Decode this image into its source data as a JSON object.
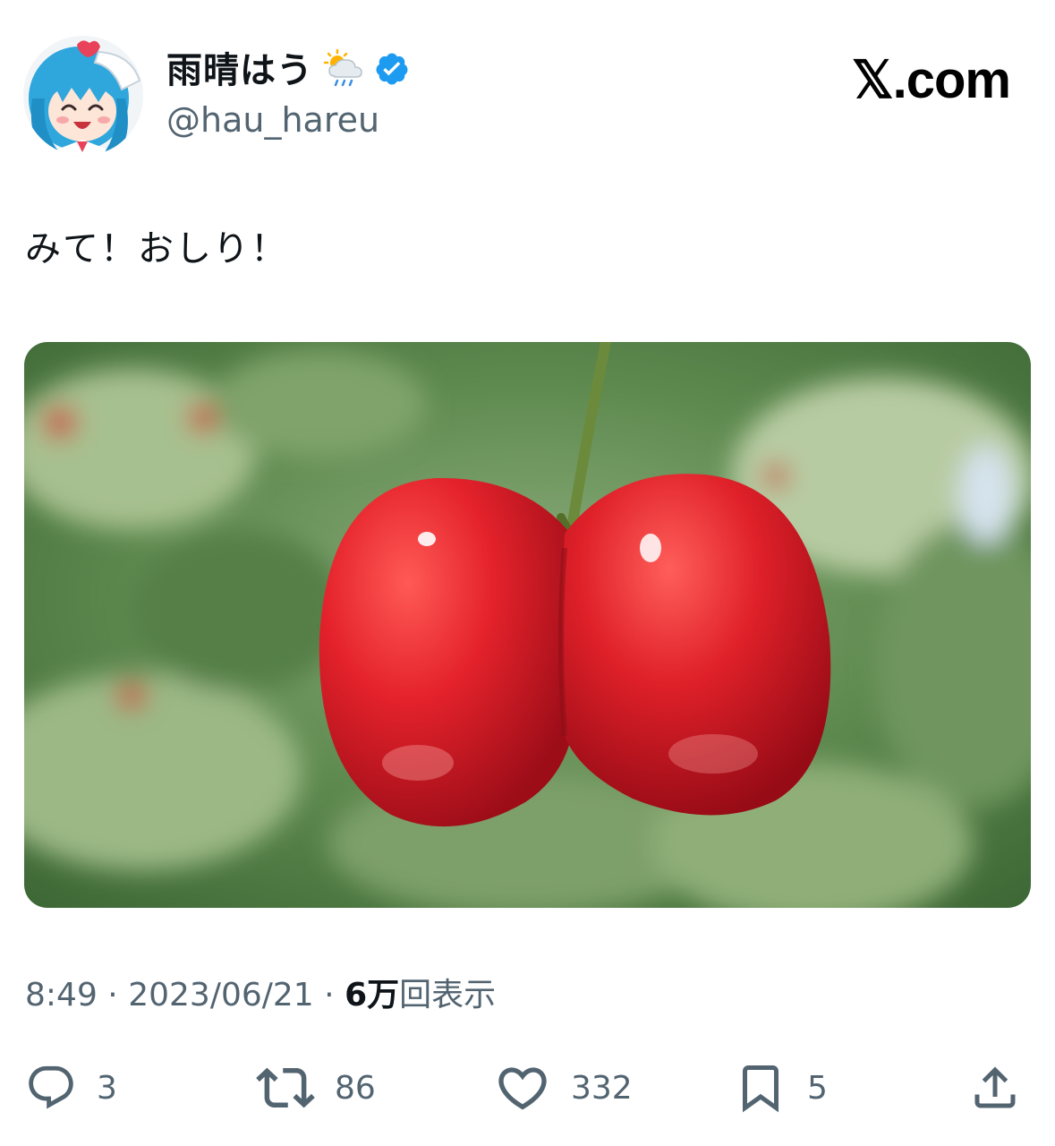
{
  "author": {
    "display_name": "雨晴はう",
    "handle": "@hau_hareu",
    "name_emoji": "sun-behind-rain-cloud-icon",
    "verified_color": "#1d9bf0"
  },
  "brand": {
    "label": "𝕏.com"
  },
  "tweet": {
    "text": "みて！おしり！"
  },
  "media": {
    "alt_icon": "cherry-photo"
  },
  "meta": {
    "time": "8:49",
    "separator": "·",
    "date": "2023/06/21",
    "views_count": "6万",
    "views_label": "回表示"
  },
  "actions": {
    "replies": "3",
    "retweets": "86",
    "likes": "332",
    "bookmarks": "5"
  },
  "colors": {
    "text_primary": "#0f1419",
    "text_secondary": "#536471",
    "accent": "#1d9bf0"
  }
}
